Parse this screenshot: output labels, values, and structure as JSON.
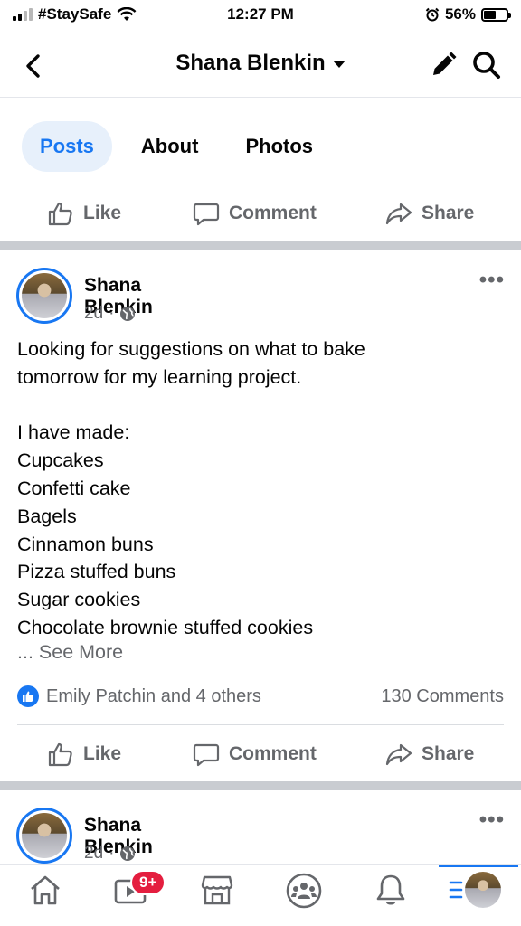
{
  "status_bar": {
    "carrier": "#StaySafe",
    "time": "12:27 PM",
    "battery": "56%",
    "battery_level": 0.56
  },
  "header": {
    "title": "Shana Blenkin"
  },
  "tabs": [
    {
      "label": "Posts",
      "active": true
    },
    {
      "label": "About",
      "active": false
    },
    {
      "label": "Photos",
      "active": false
    }
  ],
  "actions": {
    "like": "Like",
    "comment": "Comment",
    "share": "Share"
  },
  "post1": {
    "author": "Shana Blenkin",
    "time": "2d",
    "meta_separator": "·",
    "body": "Looking for suggestions on what to bake\ntomorrow for my learning project.\n\nI have made:\nCupcakes\nConfetti cake\nBagels\nCinnamon buns\nPizza stuffed buns\nSugar cookies\nChocolate brownie stuffed cookies",
    "see_more": "... See More",
    "reactions": "Emily Patchin and 4 others",
    "comments": "130 Comments"
  },
  "post2": {
    "author": "Shana Blenkin",
    "time": "2d",
    "meta_separator": "·"
  },
  "bottom_nav": {
    "watch_badge": "9+",
    "items": [
      "home-icon",
      "watch-icon",
      "marketplace-icon",
      "groups-icon",
      "notifications-icon",
      "menu-profile"
    ]
  },
  "colors": {
    "accent": "#1877f2",
    "secondary_text": "#65676b",
    "badge": "#e41e3f"
  }
}
